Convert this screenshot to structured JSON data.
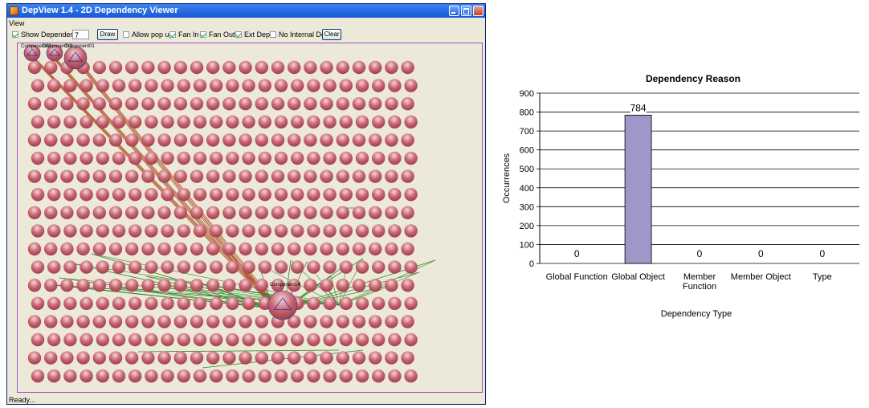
{
  "window": {
    "title": "DepView 1.4 - 2D Dependency Viewer",
    "menu_view": "View",
    "status": "Ready..."
  },
  "toolbar": {
    "show_dependency_label": "Show Dependency",
    "depth_value": "7",
    "draw_label": "Draw",
    "allow_popup_label": "Allow pop up",
    "fan_in_label": "Fan In",
    "fan_out_label": "Fan Out",
    "ext_dep_label": "Ext Dep",
    "no_internal_dep_label": "No Internal Dep",
    "clear_label": "Clear",
    "show_dependency_checked": true,
    "allow_popup_checked": false,
    "fan_in_checked": true,
    "fan_out_checked": true,
    "ext_dep_checked": true,
    "no_internal_dep_checked": false
  },
  "graph": {
    "node_labels": [
      "Component02",
      "Component03",
      "Component01",
      "Component14"
    ],
    "colors": {
      "node": "#c86470",
      "fan_in_edge": "#2e8b2e",
      "fan_out_edge": "#b0552e",
      "selection": "#9e4ec8"
    }
  },
  "chart_data": {
    "type": "bar",
    "title": "Dependency Reason",
    "xlabel": "Dependency Type",
    "ylabel": "Occurrences",
    "categories": [
      "Global Function",
      "Global Object",
      "Member Function",
      "Member Object",
      "Type"
    ],
    "values": [
      0,
      784,
      0,
      0,
      0
    ],
    "data_labels": [
      "0",
      "784",
      "0",
      "0",
      "0"
    ],
    "ylim": [
      0,
      900
    ],
    "yticks": [
      0,
      100,
      200,
      300,
      400,
      500,
      600,
      700,
      800,
      900
    ],
    "grid": true,
    "legend": "none",
    "bar_color": "#9d98c8"
  }
}
